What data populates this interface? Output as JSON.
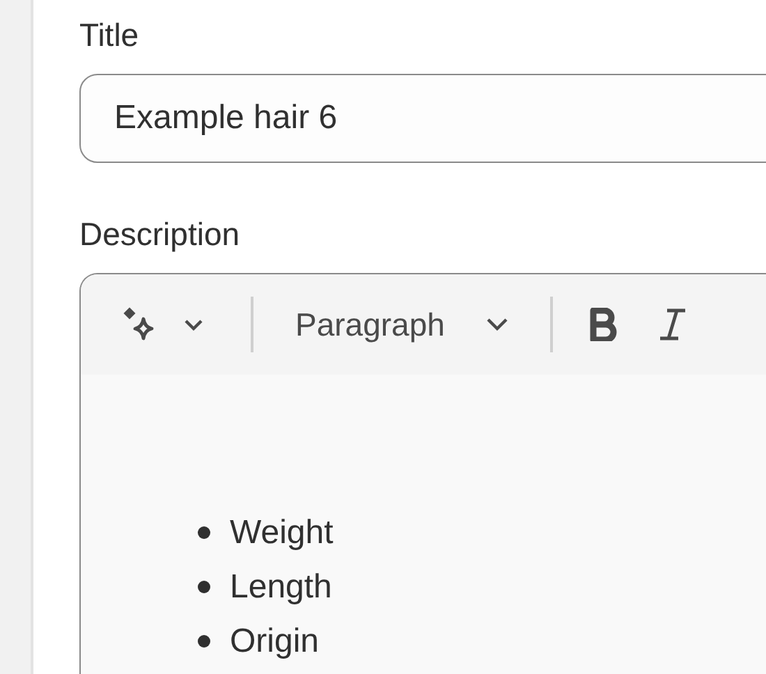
{
  "title_field": {
    "label": "Title",
    "value": "Example hair 6"
  },
  "description": {
    "label": "Description",
    "format": "Paragraph",
    "bullets": [
      "Weight",
      "Length",
      "Origin"
    ]
  }
}
